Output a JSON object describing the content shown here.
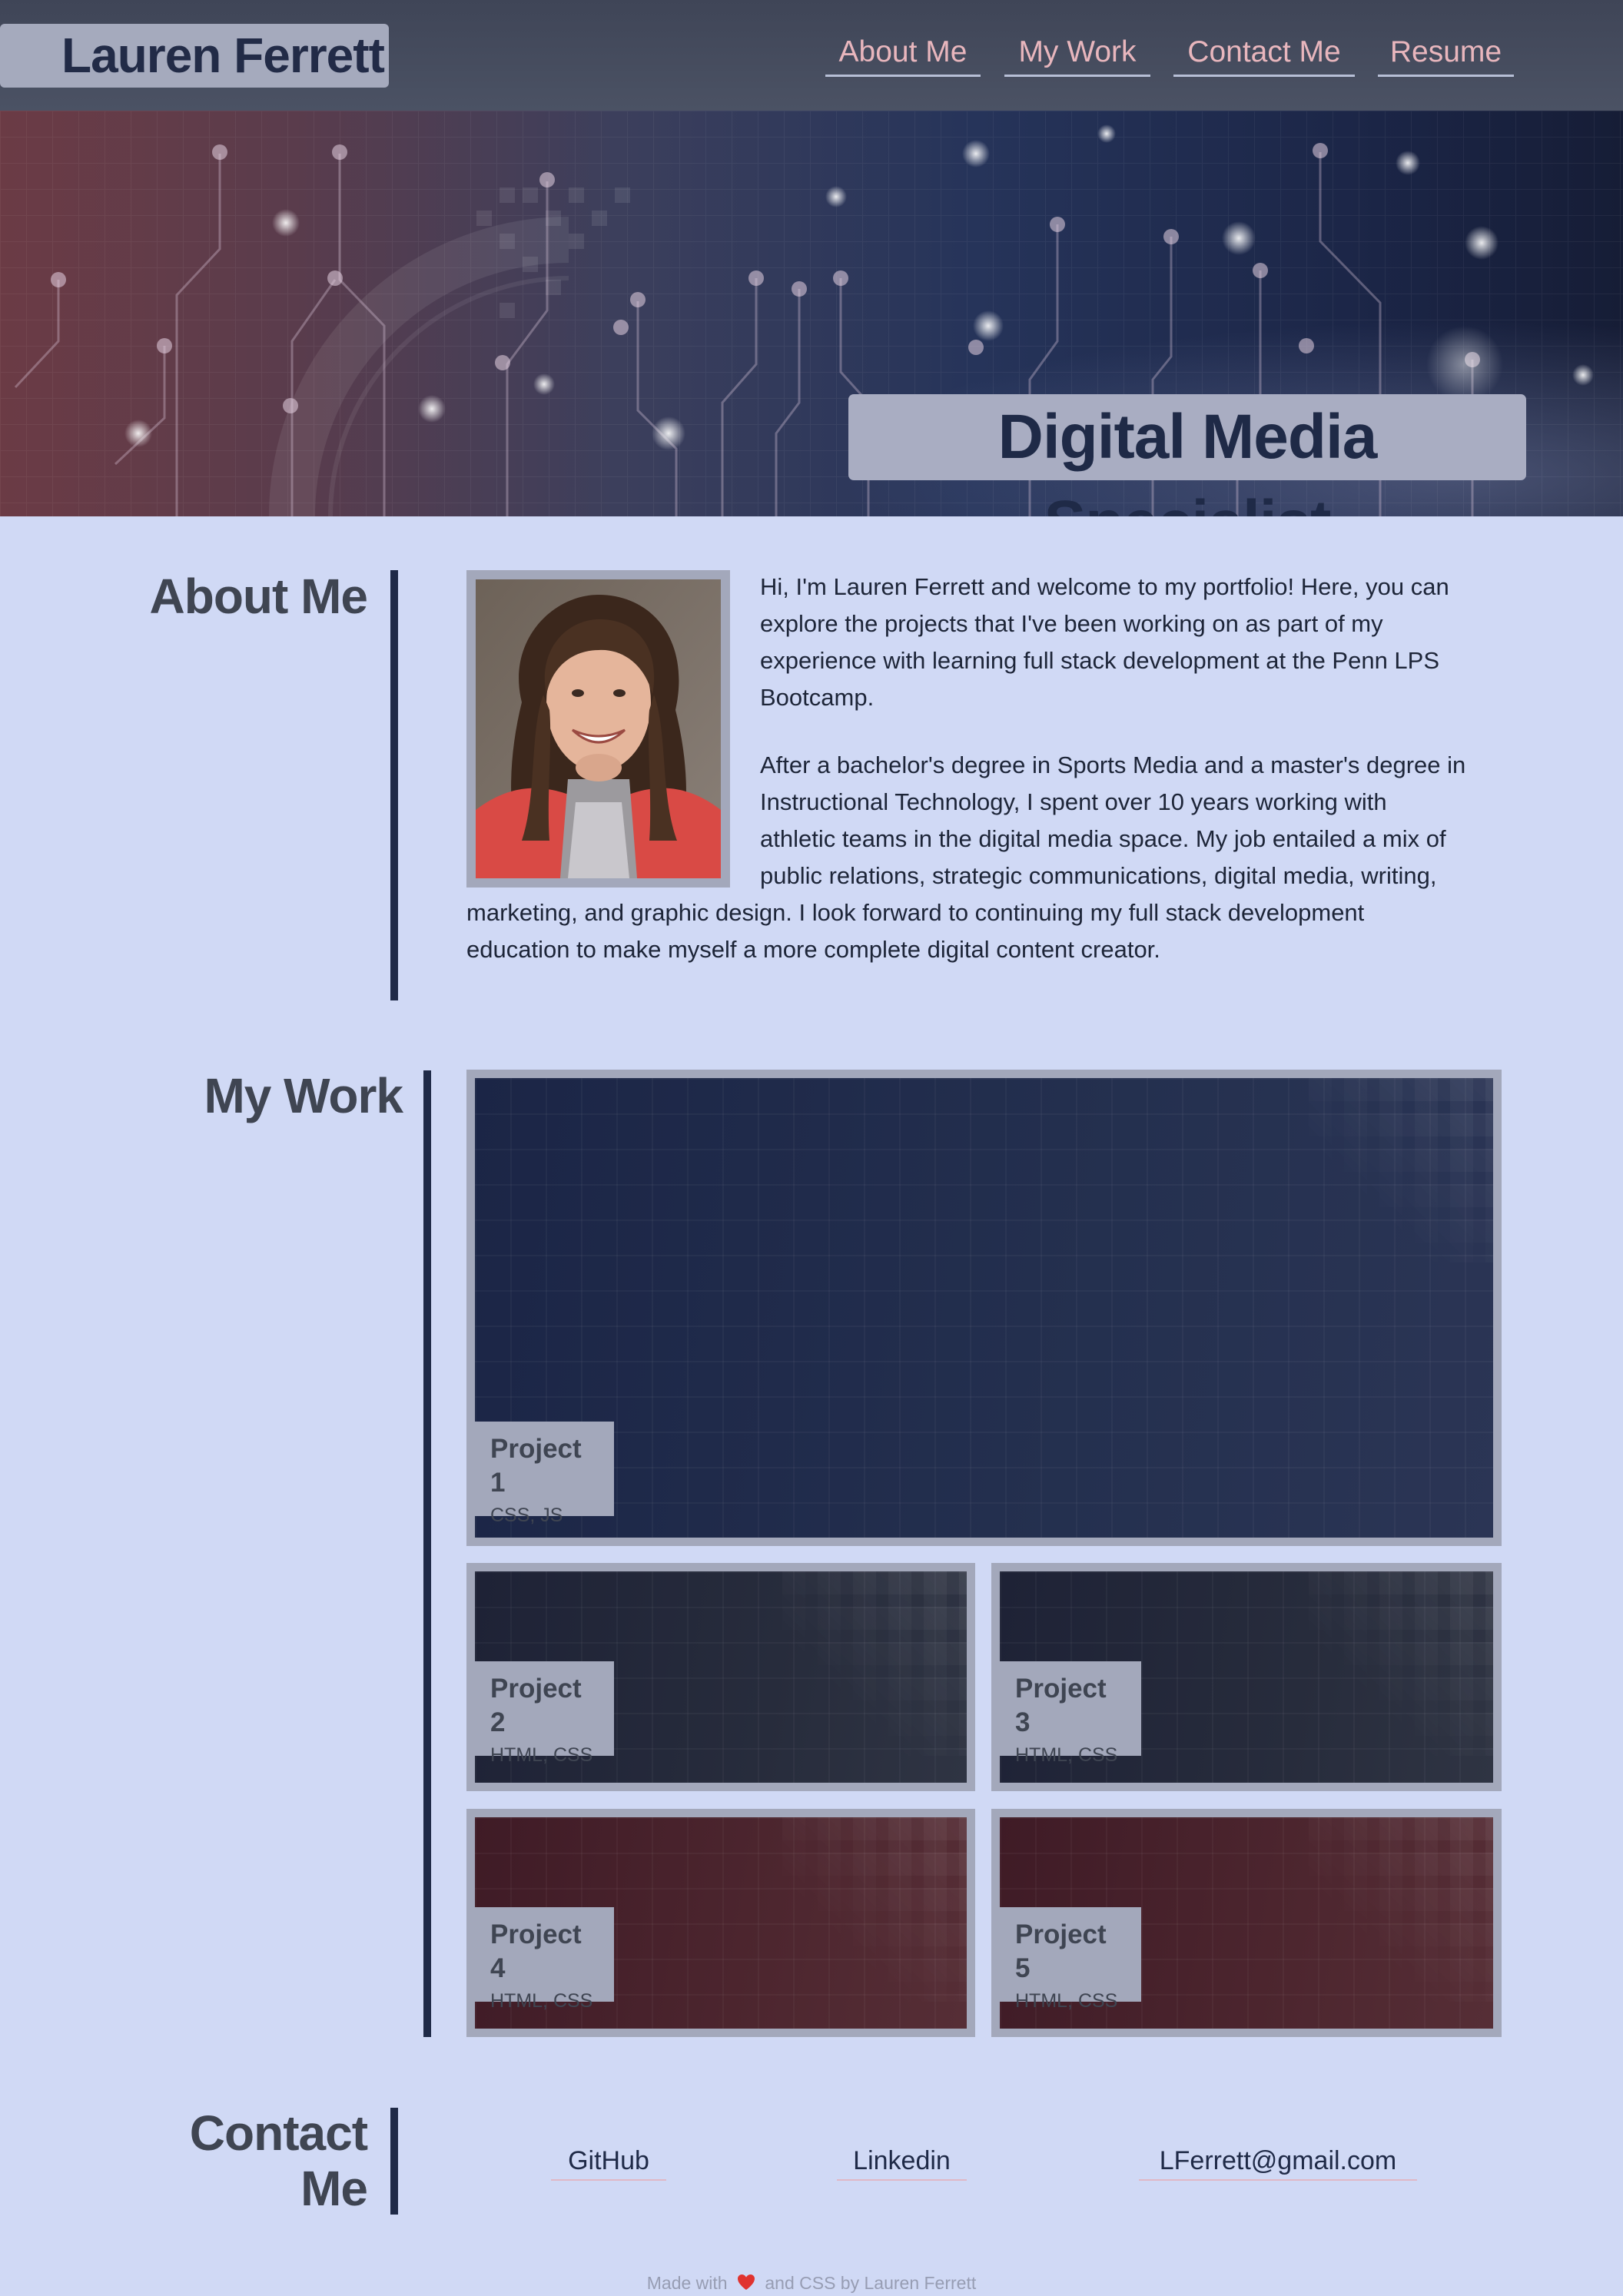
{
  "header": {
    "site_title": "Lauren Ferrett",
    "nav": [
      {
        "label": "About Me"
      },
      {
        "label": "My Work"
      },
      {
        "label": "Contact Me"
      },
      {
        "label": "Resume"
      }
    ]
  },
  "hero": {
    "title": "Digital Media Specialist"
  },
  "about": {
    "heading": "About Me",
    "paragraph_1": "Hi, I'm Lauren Ferrett and welcome to my portfolio! Here, you can explore the projects that I've been working on as part of my experience with learning full stack development at the Penn LPS Bootcamp.",
    "paragraph_2_lines": [
      "After a bachelor's degree in Sports Media and a master's degree in",
      "Instructional Technology, I spent over 10 years working with",
      "athletic teams in the digital media space. My job entailed a mix of",
      "public relations, strategic communications, digital media, writing,",
      "marketing, and graphic design. I look forward to continuing my full stack development",
      "education to make myself a more complete digital content creator."
    ],
    "paragraph_1_lines": [
      "Hi, I'm Lauren Ferrett and welcome to my portfolio! Here, you can",
      "explore the projects that I've been working on as part of my",
      "experience with learning full stack development at the Penn LPS",
      "Bootcamp."
    ]
  },
  "work": {
    "heading": "My Work",
    "projects": [
      {
        "name": "Project 1",
        "tech": "CSS, JS"
      },
      {
        "name": "Project 2",
        "tech": "HTML, CSS"
      },
      {
        "name": "Project 3",
        "tech": "HTML, CSS"
      },
      {
        "name": "Project 4",
        "tech": "HTML, CSS"
      },
      {
        "name": "Project 5",
        "tech": "HTML, CSS"
      }
    ]
  },
  "contact": {
    "heading_line_1": "Contact",
    "heading_line_2": "Me",
    "links": [
      {
        "label": "GitHub"
      },
      {
        "label": "Linkedin"
      },
      {
        "label": "LFerrett@gmail.com"
      }
    ]
  },
  "footer": {
    "prefix": "Made with",
    "suffix": "and CSS by Lauren Ferrett",
    "heart_icon": "heart-icon"
  },
  "colors": {
    "page_background": "#d0d9f5",
    "header_background": "#454b5d",
    "nav_link": "#e8b6bd",
    "accent_navy": "#1f2a47",
    "card_frame": "#a3a8bb"
  }
}
